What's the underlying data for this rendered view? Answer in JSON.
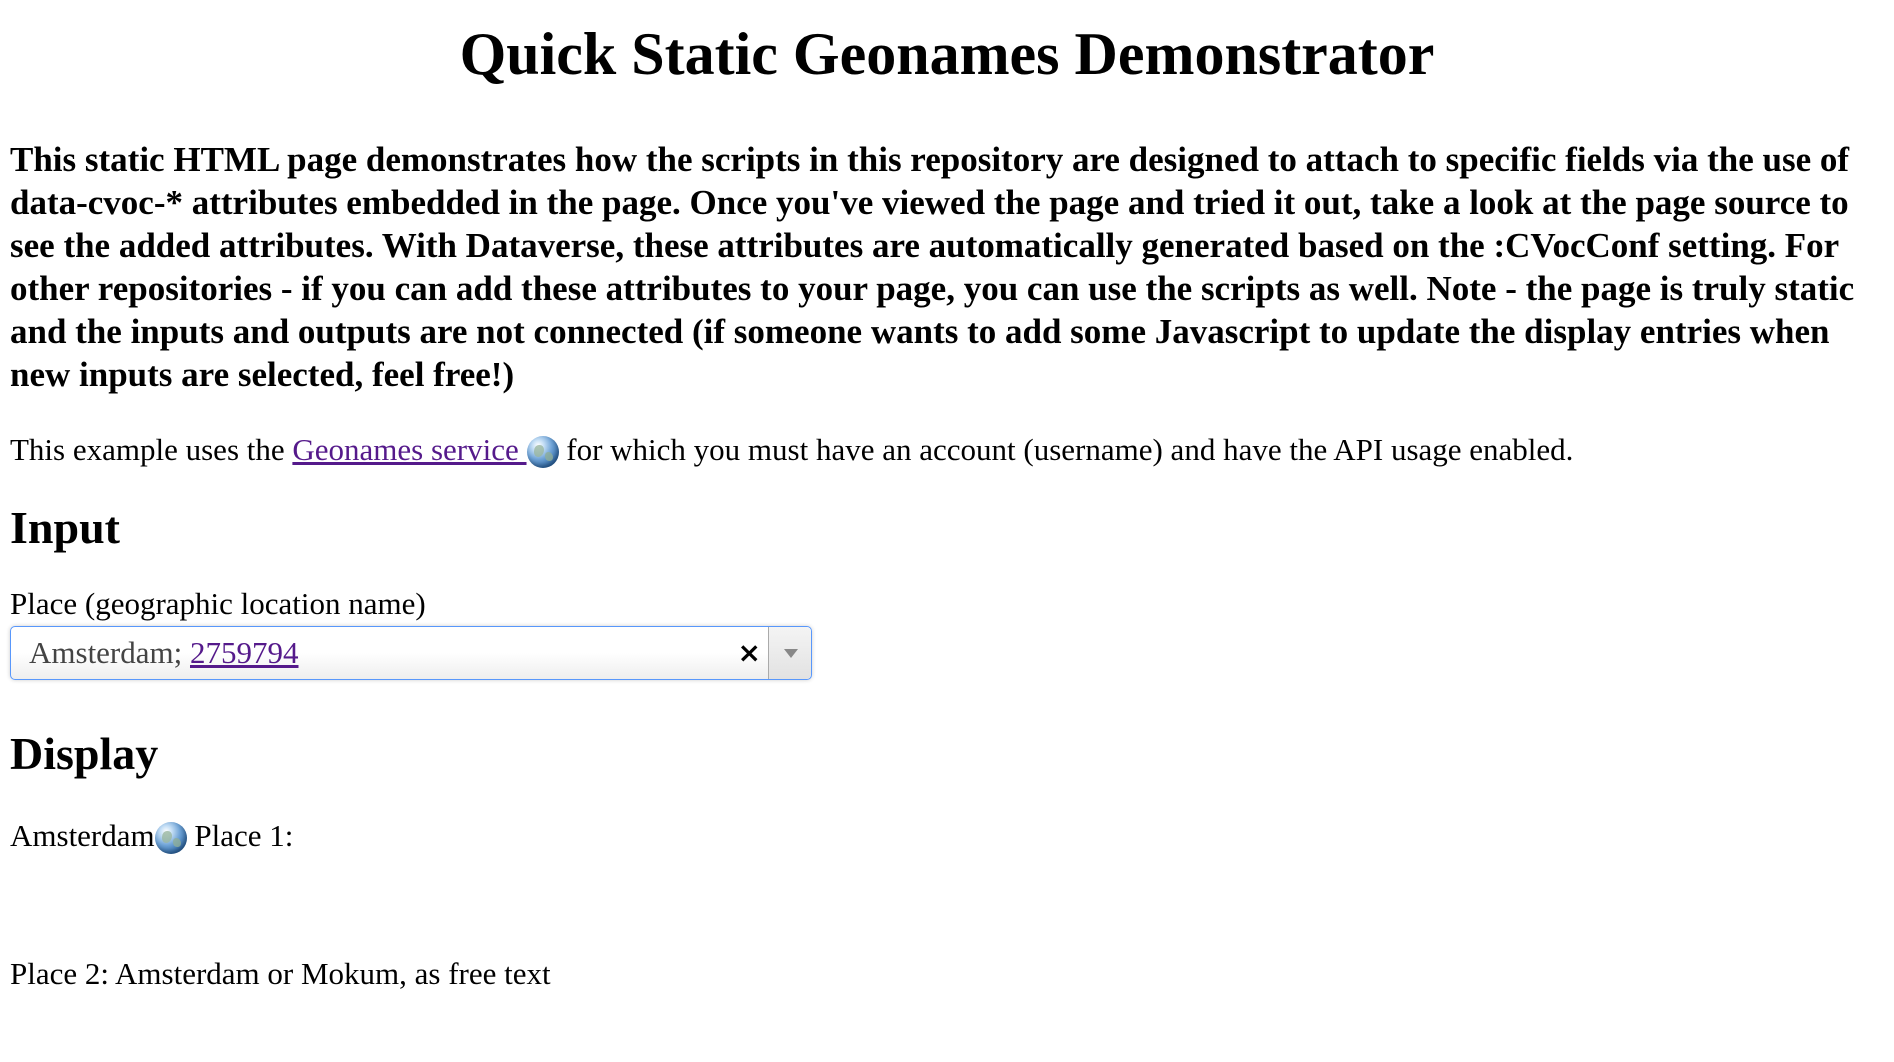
{
  "page": {
    "title": "Quick Static Geonames Demonstrator",
    "intro": "This static HTML page demonstrates how the scripts in this repository are designed to attach to specific fields via the use of data-cvoc-* attributes embedded in the page. Once you've viewed the page and tried it out, take a look at the page source to see the added attributes. With Dataverse, these attributes are automatically generated based on the :CVocConf setting. For other repositories - if you can add these attributes to your page, you can use the scripts as well. Note - the page is truly static and the inputs and outputs are not connected (if someone wants to add some Javascript to update the display entries when new inputs are selected, feel free!)"
  },
  "service_line": {
    "prefix": "This example uses the ",
    "link_text": "Geonames service ",
    "suffix": " for which you must have an account (username) and have the API usage enabled.",
    "icon": "globe-icon"
  },
  "input_section": {
    "heading": "Input",
    "field_label": "Place (geographic location name)",
    "select": {
      "value_text": "Amsterdam; ",
      "value_link": "2759794",
      "clear_glyph": "×",
      "accent_color": "#5897fb"
    }
  },
  "display_section": {
    "heading": "Display",
    "place1": {
      "name": "Amsterdam",
      "icon": "globe-icon",
      "label": " Place 1:"
    },
    "place2": "Place 2: Amsterdam or Mokum, as free text"
  }
}
